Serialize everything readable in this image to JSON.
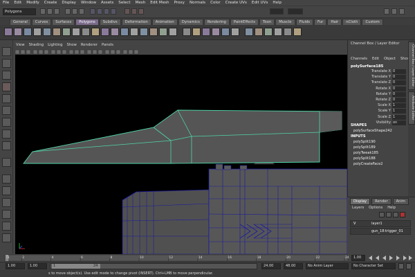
{
  "menubar": [
    "File",
    "Edit",
    "Modify",
    "Create",
    "Display",
    "Window",
    "Assets",
    "Select",
    "Mesh",
    "Edit Mesh",
    "Proxy",
    "Normals",
    "Color",
    "Create UVs",
    "Edit UVs",
    "Help"
  ],
  "status": {
    "mode": "Polygons"
  },
  "shelf_tabs": [
    "General",
    "Curves",
    "Surfaces",
    "Polygons",
    "Subdivs",
    "Deformation",
    "Animation",
    "Dynamics",
    "Rendering",
    "PaintEffects",
    "Toon",
    "Muscle",
    "Fluids",
    "Fur",
    "Hair",
    "nCloth",
    "Custom"
  ],
  "shelf_active": "Polygons",
  "panel_menu": [
    "View",
    "Shading",
    "Lighting",
    "Show",
    "Renderer",
    "Panels"
  ],
  "channel_box": {
    "title": "Channel Box / Layer Editor",
    "menu": [
      "Channels",
      "Edit",
      "Object",
      "Show"
    ],
    "object": "polySurface185",
    "attributes": [
      {
        "name": "Translate X",
        "value": "0"
      },
      {
        "name": "Translate Y",
        "value": "0"
      },
      {
        "name": "Translate Z",
        "value": "0"
      },
      {
        "name": "Rotate X",
        "value": "0"
      },
      {
        "name": "Rotate Y",
        "value": "0"
      },
      {
        "name": "Rotate Z",
        "value": "0"
      },
      {
        "name": "Scale X",
        "value": "1"
      },
      {
        "name": "Scale Y",
        "value": "1"
      },
      {
        "name": "Scale Z",
        "value": "1"
      },
      {
        "name": "Visibility",
        "value": "on"
      }
    ],
    "shapes_heading": "SHAPES",
    "shapes": [
      "polySurfaceShape242"
    ],
    "inputs_heading": "INPUTS",
    "inputs": [
      "polySplit190",
      "polySplit189",
      "polyTweak185",
      "polySplit188",
      "polyCreateFace2"
    ]
  },
  "side_tabs": [
    "Channel Box / Layer Editor",
    "Attribute Editor"
  ],
  "layer_editor": {
    "tabs": [
      "Display",
      "Render",
      "Anim"
    ],
    "menu": [
      "Layers",
      "Options",
      "Help"
    ],
    "layers": [
      {
        "visible": "V",
        "name": "layer1"
      },
      {
        "visible": "",
        "name": "gun_18:trigger_01"
      }
    ]
  },
  "timeline": {
    "ticks": [
      "1",
      "2",
      "4",
      "6",
      "8",
      "10",
      "12",
      "14",
      "16",
      "18",
      "20",
      "22",
      "24"
    ],
    "current_frame": "1.00",
    "range_start": "1.00",
    "range_start2": "1.00",
    "playback_start": "1",
    "playback_end": "24",
    "range_end": "24.00",
    "range_end2": "48.00",
    "anim_layer": "No Anim Layer",
    "char_set": "No Character Set"
  },
  "help_line": "Move Tool: Use manip to move object(s). Use edit mode to change pivot (INSERT). Ctrl+LMB to move perpendicular.",
  "help_visible": "s to move object(s). Use edit mode to change pivot (INSERT).  Ctrl+LMB to move perpendicular.",
  "colors": {
    "selection_wire": "#4fd6a6",
    "mesh_wire": "#1a1aa0",
    "mesh_fill": "#555555",
    "viewport_bg": "#000000",
    "shelf_active": "#7a6a8a"
  },
  "icons": [
    "select-tool-icon",
    "lasso-tool-icon",
    "paint-select-icon",
    "move-tool-icon",
    "rotate-tool-icon",
    "scale-tool-icon",
    "universal-manip-icon",
    "soft-mod-icon",
    "show-manip-icon",
    "layout-single-icon",
    "layout-four-icon",
    "layout-persp-outliner-icon",
    "layout-persp-graph-icon",
    "axis-gizmo-icon"
  ]
}
